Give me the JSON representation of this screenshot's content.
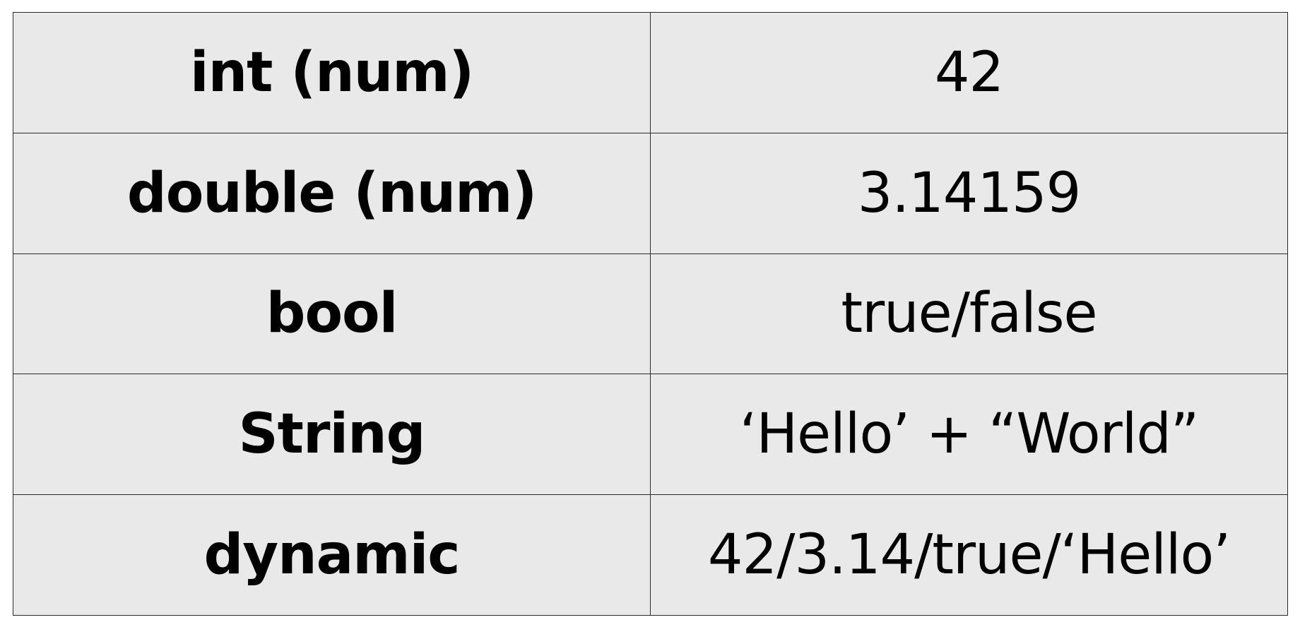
{
  "table": {
    "rows": [
      {
        "type": "int (num)",
        "value": "42"
      },
      {
        "type": "double (num)",
        "value": "3.14159"
      },
      {
        "type": "bool",
        "value": "true/false"
      },
      {
        "type": "String",
        "value": "‘Hello’ + “World”"
      },
      {
        "type": "dynamic",
        "value": "42/3.14/true/‘Hello’"
      }
    ]
  },
  "colors": {
    "cell_background": "#e9e9e9",
    "border": "#2a2a2a",
    "text": "#000000"
  }
}
